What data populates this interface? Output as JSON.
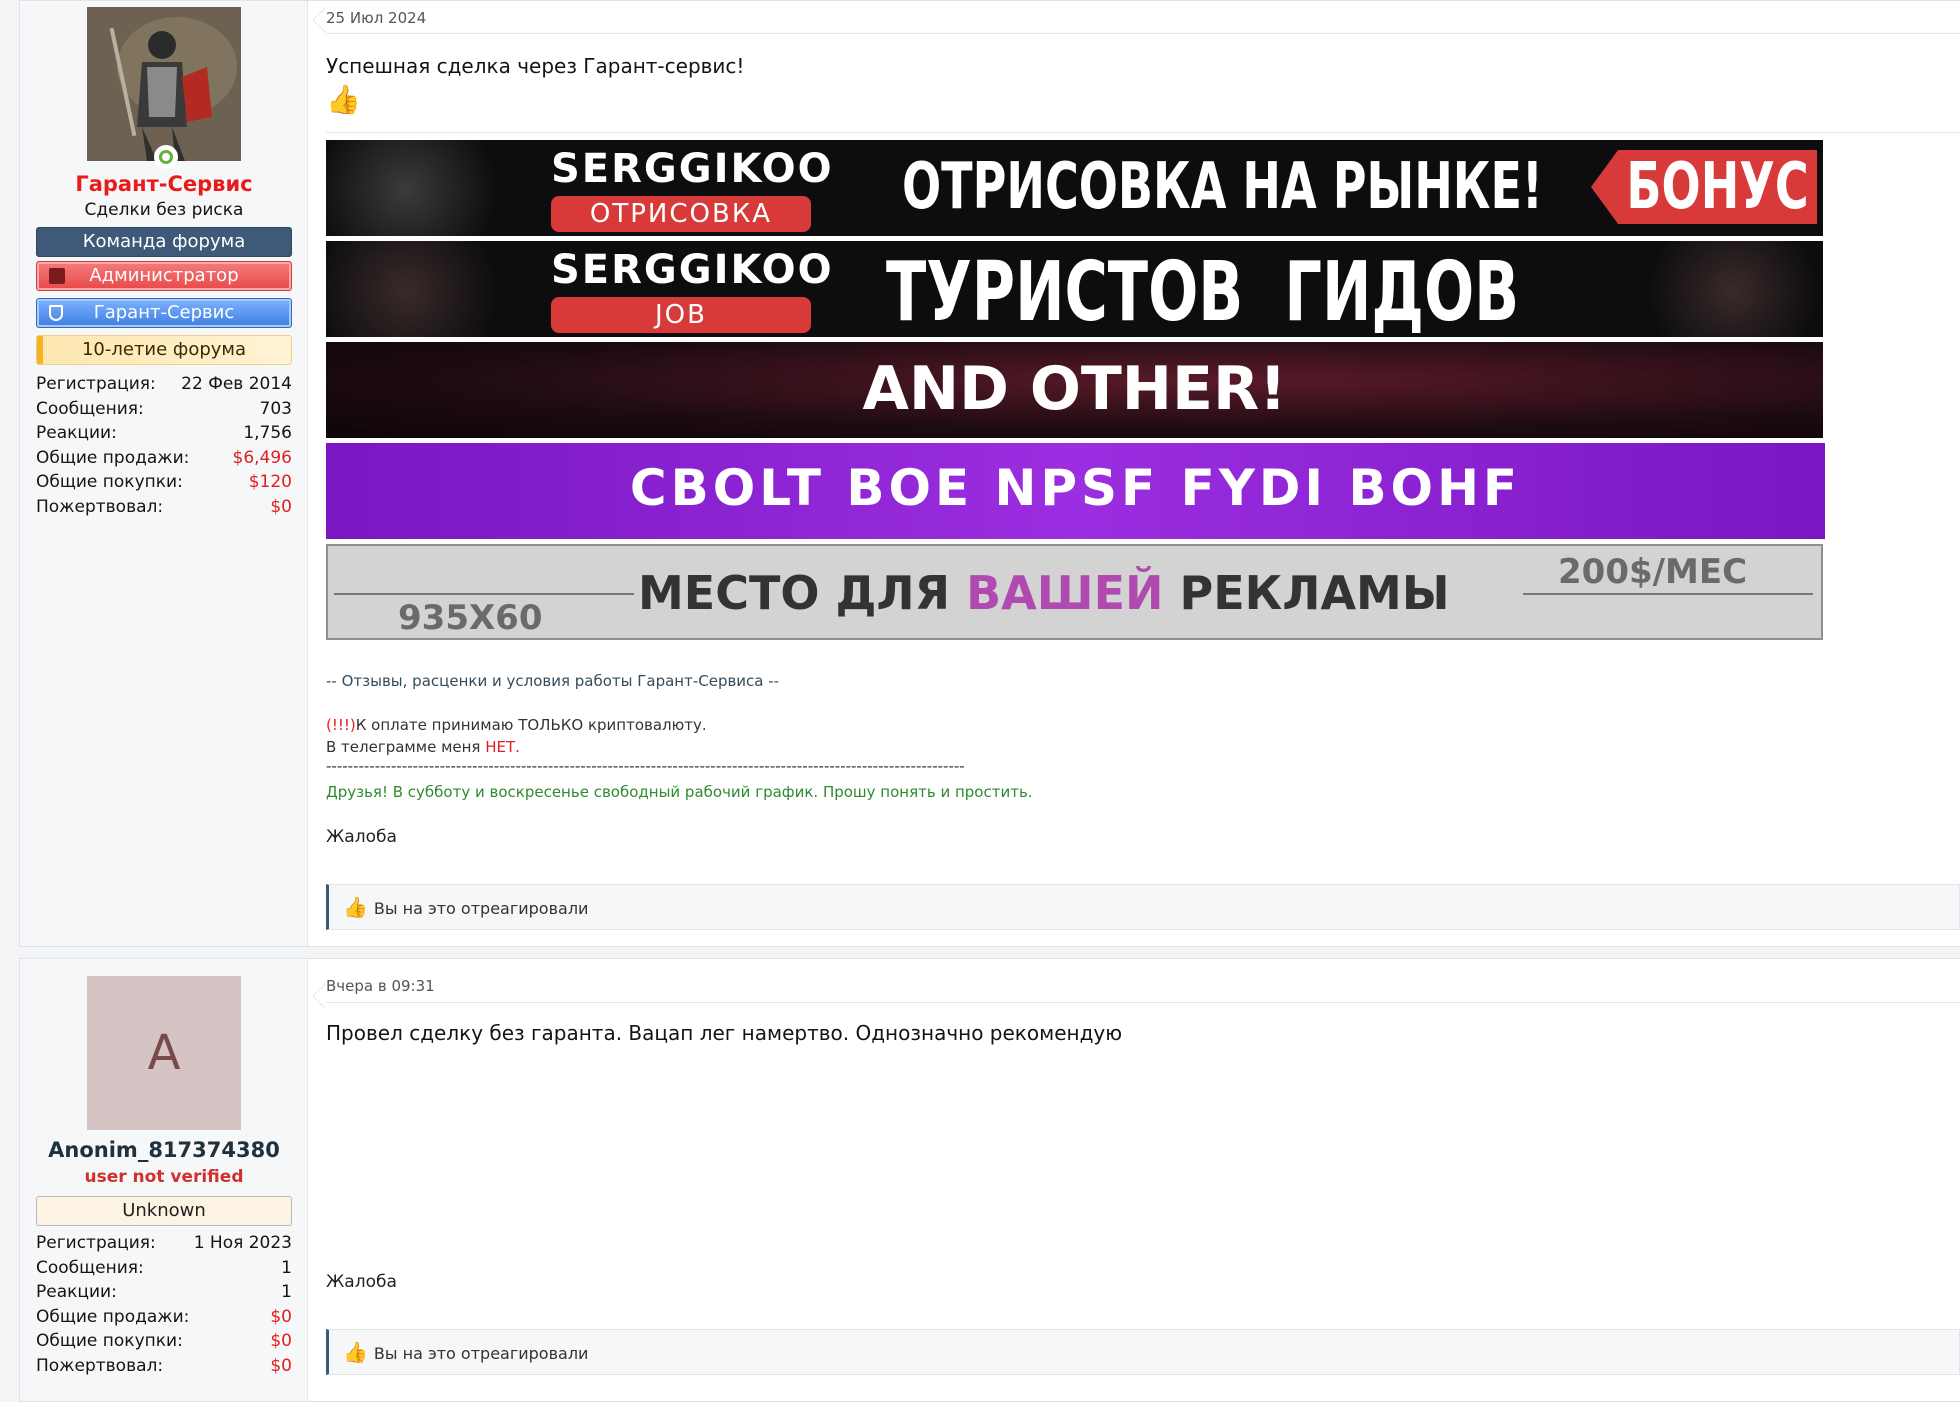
{
  "post1": {
    "user": {
      "name": "Гарант-Сервис",
      "title": "Сделки без риска",
      "avatar_icon": "knight-avatar",
      "badges": [
        "Команда форума",
        "Администратор",
        "Гарант-Сервис",
        "10-летие форума"
      ],
      "stats": [
        {
          "label": "Регистрация:",
          "value": "22 Фев 2014"
        },
        {
          "label": "Сообщения:",
          "value": "703"
        },
        {
          "label": "Реакции:",
          "value": "1,756"
        },
        {
          "label": "Общие продажи:",
          "value": "$6,496"
        },
        {
          "label": "Общие покупки:",
          "value": "$120"
        },
        {
          "label": "Пожертвовал:",
          "value": "$0"
        }
      ]
    },
    "date": "25 Июл 2024",
    "message": "Успешная сделка через Гарант-сервис!",
    "emoji": "👍",
    "banners": {
      "b1": {
        "brand": "SERGGIKOO",
        "tag": "ОТРИСОВКА",
        "text": "ОТРИСОВКА НА РЫНКЕ! +",
        "bonus": "БОНУС"
      },
      "b2": {
        "brand": "SERGGIKOO",
        "tag": "JOB",
        "text": "ТУРИСТОВ  ГИДОВ"
      },
      "b3": {
        "text": "AND OTHER!"
      },
      "b4": {
        "text": "CBOLT BOE NPSF FYDI BOHF"
      },
      "b5": {
        "size": "935X60",
        "text1": "МЕСТО ДЛЯ ",
        "text2": "ВАШЕЙ",
        "text3": " РЕКЛАМЫ",
        "price": "200$/MEC"
      }
    },
    "sig": {
      "line1": "-- Отзывы, расценки и условия работы Гарант-Сервиса --",
      "warn": "(!!!)",
      "line2": "К оплате принимаю ТОЛЬКО криптовалюту.",
      "line3a": "В телеграмме меня ",
      "line3b": "НЕТ.",
      "dashes": "----------------------------------------------------------------------------------------------------------------------",
      "line4": "Друзья! В субботу и воскресенье свободный рабочий график. Прошу понять и простить."
    },
    "complain": "Жалоба",
    "react": "Вы на это отреагировали"
  },
  "post2": {
    "user": {
      "name": "Anonim_817374380",
      "title": "user not verified",
      "avatar_letter": "A",
      "badge": "Unknown",
      "stats": [
        {
          "label": "Регистрация:",
          "value": "1 Ноя 2023"
        },
        {
          "label": "Сообщения:",
          "value": "1"
        },
        {
          "label": "Реакции:",
          "value": "1"
        },
        {
          "label": "Общие продажи:",
          "value": "$0"
        },
        {
          "label": "Общие покупки:",
          "value": "$0"
        },
        {
          "label": "Пожертвовал:",
          "value": "$0"
        }
      ]
    },
    "date": "Вчера в 09:31",
    "message": "Провел сделку без гаранта. Вацап лег намертво. Однозначно рекомендую",
    "complain": "Жалоба",
    "react": "Вы на это отреагировали"
  },
  "colors": {
    "accent": "#3a5a74",
    "red": "#e02020",
    "green": "#2e8b2e",
    "admin": "#e94848",
    "guarant": "#3d7fe0"
  }
}
